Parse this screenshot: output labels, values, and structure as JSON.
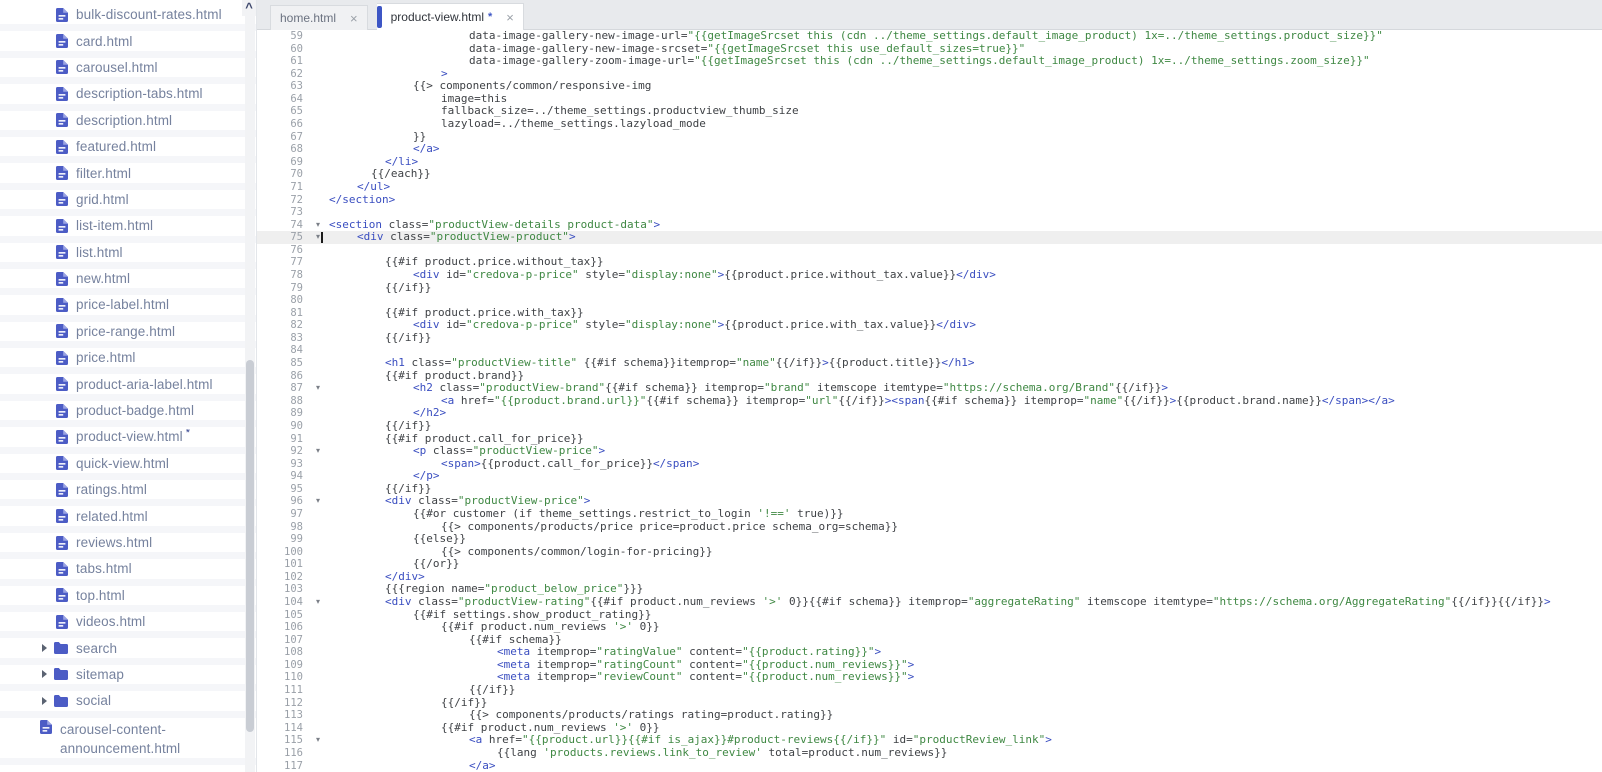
{
  "colors": {
    "accent_blue": "#3d56c5",
    "icon_indigo": "#4c5cc5",
    "syntax_tag": "#3a4ec0",
    "syntax_string": "#3f8843",
    "syntax_text": "#3f4246",
    "active_line_bg": "#efefef"
  },
  "sidebar": {
    "items": [
      {
        "type": "file",
        "name": "bulk-discount-rates.html"
      },
      {
        "type": "file",
        "name": "card.html"
      },
      {
        "type": "file",
        "name": "carousel.html"
      },
      {
        "type": "file",
        "name": "description-tabs.html"
      },
      {
        "type": "file",
        "name": "description.html"
      },
      {
        "type": "file",
        "name": "featured.html"
      },
      {
        "type": "file",
        "name": "filter.html"
      },
      {
        "type": "file",
        "name": "grid.html"
      },
      {
        "type": "file",
        "name": "list-item.html"
      },
      {
        "type": "file",
        "name": "list.html"
      },
      {
        "type": "file",
        "name": "new.html"
      },
      {
        "type": "file",
        "name": "price-label.html"
      },
      {
        "type": "file",
        "name": "price-range.html"
      },
      {
        "type": "file",
        "name": "price.html"
      },
      {
        "type": "file",
        "name": "product-aria-label.html"
      },
      {
        "type": "file",
        "name": "product-badge.html"
      },
      {
        "type": "file",
        "name": "product-view.html",
        "modified": true
      },
      {
        "type": "file",
        "name": "quick-view.html"
      },
      {
        "type": "file",
        "name": "ratings.html"
      },
      {
        "type": "file",
        "name": "related.html"
      },
      {
        "type": "file",
        "name": "reviews.html"
      },
      {
        "type": "file",
        "name": "tabs.html"
      },
      {
        "type": "file",
        "name": "top.html"
      },
      {
        "type": "file",
        "name": "videos.html"
      },
      {
        "type": "folder",
        "name": "search"
      },
      {
        "type": "folder",
        "name": "sitemap"
      },
      {
        "type": "folder",
        "name": "social"
      },
      {
        "type": "file",
        "name": "carousel-content-announcement.html",
        "outdent": true
      }
    ]
  },
  "tabs": [
    {
      "label": "home.html",
      "active": false,
      "modified": false
    },
    {
      "label": "product-view.html",
      "active": true,
      "modified": true
    }
  ],
  "editor": {
    "first_line": 59,
    "last_line": 117,
    "active_line": 75,
    "cursor": {
      "line": 75,
      "col": 0
    },
    "fold_lines": [
      74,
      75,
      87,
      92,
      96,
      104,
      115
    ],
    "lines": [
      {
        "n": 59,
        "i": 20,
        "t": "data-image-gallery-new-image-url=\"{{getImageSrcset this (cdn ../theme_settings.default_image_product) 1x=../theme_settings.product_size}}\""
      },
      {
        "n": 60,
        "i": 20,
        "t": "data-image-gallery-new-image-srcset=\"{{getImageSrcset this use_default_sizes=true}}\""
      },
      {
        "n": 61,
        "i": 20,
        "t": "data-image-gallery-zoom-image-url=\"{{getImageSrcset this (cdn ../theme_settings.default_image_product) 1x=../theme_settings.zoom_size}}\""
      },
      {
        "n": 62,
        "i": 16,
        "t": ">"
      },
      {
        "n": 63,
        "i": 12,
        "t": "{{> components/common/responsive-img"
      },
      {
        "n": 64,
        "i": 16,
        "t": "image=this"
      },
      {
        "n": 65,
        "i": 16,
        "t": "fallback_size=../theme_settings.productview_thumb_size"
      },
      {
        "n": 66,
        "i": 16,
        "t": "lazyload=../theme_settings.lazyload_mode"
      },
      {
        "n": 67,
        "i": 12,
        "t": "}}"
      },
      {
        "n": 68,
        "i": 12,
        "t": "</a>"
      },
      {
        "n": 69,
        "i": 8,
        "t": "</li>"
      },
      {
        "n": 70,
        "i": 6,
        "t": "{{/each}}"
      },
      {
        "n": 71,
        "i": 4,
        "t": "</ul>"
      },
      {
        "n": 72,
        "i": 0,
        "t": "</section>"
      },
      {
        "n": 73,
        "i": 0,
        "t": ""
      },
      {
        "n": 74,
        "i": 0,
        "t": "<section class=\"productView-details product-data\">"
      },
      {
        "n": 75,
        "i": 4,
        "t": "<div class=\"productView-product\">"
      },
      {
        "n": 76,
        "i": 0,
        "t": ""
      },
      {
        "n": 77,
        "i": 8,
        "t": "{{#if product.price.without_tax}}"
      },
      {
        "n": 78,
        "i": 12,
        "t": "<div id=\"credova-p-price\" style=\"display:none\">{{product.price.without_tax.value}}</div>"
      },
      {
        "n": 79,
        "i": 8,
        "t": "{{/if}}"
      },
      {
        "n": 80,
        "i": 0,
        "t": ""
      },
      {
        "n": 81,
        "i": 8,
        "t": "{{#if product.price.with_tax}}"
      },
      {
        "n": 82,
        "i": 12,
        "t": "<div id=\"credova-p-price\" style=\"display:none\">{{product.price.with_tax.value}}</div>"
      },
      {
        "n": 83,
        "i": 8,
        "t": "{{/if}}"
      },
      {
        "n": 84,
        "i": 0,
        "t": ""
      },
      {
        "n": 85,
        "i": 8,
        "t": "<h1 class=\"productView-title\" {{#if schema}}itemprop=\"name\"{{/if}}>{{product.title}}</h1>"
      },
      {
        "n": 86,
        "i": 8,
        "t": "{{#if product.brand}}"
      },
      {
        "n": 87,
        "i": 12,
        "t": "<h2 class=\"productView-brand\"{{#if schema}} itemprop=\"brand\" itemscope itemtype=\"https://schema.org/Brand\"{{/if}}>"
      },
      {
        "n": 88,
        "i": 16,
        "t": "<a href=\"{{product.brand.url}}\"{{#if schema}} itemprop=\"url\"{{/if}}><span{{#if schema}} itemprop=\"name\"{{/if}}>{{product.brand.name}}</span></a>"
      },
      {
        "n": 89,
        "i": 12,
        "t": "</h2>"
      },
      {
        "n": 90,
        "i": 8,
        "t": "{{/if}}"
      },
      {
        "n": 91,
        "i": 8,
        "t": "{{#if product.call_for_price}}"
      },
      {
        "n": 92,
        "i": 12,
        "t": "<p class=\"productView-price\">"
      },
      {
        "n": 93,
        "i": 16,
        "t": "<span>{{product.call_for_price}}</span>"
      },
      {
        "n": 94,
        "i": 12,
        "t": "</p>"
      },
      {
        "n": 95,
        "i": 8,
        "t": "{{/if}}"
      },
      {
        "n": 96,
        "i": 8,
        "t": "<div class=\"productView-price\">"
      },
      {
        "n": 97,
        "i": 12,
        "t": "{{#or customer (if theme_settings.restrict_to_login '!==' true)}}"
      },
      {
        "n": 98,
        "i": 16,
        "t": "{{> components/products/price price=product.price schema_org=schema}}"
      },
      {
        "n": 99,
        "i": 12,
        "t": "{{else}}"
      },
      {
        "n": 100,
        "i": 16,
        "t": "{{> components/common/login-for-pricing}}"
      },
      {
        "n": 101,
        "i": 12,
        "t": "{{/or}}"
      },
      {
        "n": 102,
        "i": 8,
        "t": "</div>"
      },
      {
        "n": 103,
        "i": 8,
        "t": "{{{region name=\"product_below_price\"}}}"
      },
      {
        "n": 104,
        "i": 8,
        "t": "<div class=\"productView-rating\"{{#if product.num_reviews '>' 0}}{{#if schema}} itemprop=\"aggregateRating\" itemscope itemtype=\"https://schema.org/AggregateRating\"{{/if}}{{/if}}>"
      },
      {
        "n": 105,
        "i": 12,
        "t": "{{#if settings.show_product_rating}}"
      },
      {
        "n": 106,
        "i": 16,
        "t": "{{#if product.num_reviews '>' 0}}"
      },
      {
        "n": 107,
        "i": 20,
        "t": "{{#if schema}}"
      },
      {
        "n": 108,
        "i": 24,
        "t": "<meta itemprop=\"ratingValue\" content=\"{{product.rating}}\">"
      },
      {
        "n": 109,
        "i": 24,
        "t": "<meta itemprop=\"ratingCount\" content=\"{{product.num_reviews}}\">"
      },
      {
        "n": 110,
        "i": 24,
        "t": "<meta itemprop=\"reviewCount\" content=\"{{product.num_reviews}}\">"
      },
      {
        "n": 111,
        "i": 20,
        "t": "{{/if}}"
      },
      {
        "n": 112,
        "i": 16,
        "t": "{{/if}}"
      },
      {
        "n": 113,
        "i": 20,
        "t": "{{> components/products/ratings rating=product.rating}}"
      },
      {
        "n": 114,
        "i": 16,
        "t": "{{#if product.num_reviews '>' 0}}"
      },
      {
        "n": 115,
        "i": 20,
        "t": "<a href=\"{{product.url}}{{#if is_ajax}}#product-reviews{{/if}}\" id=\"productReview_link\">"
      },
      {
        "n": 116,
        "i": 24,
        "t": "{{lang 'products.reviews.link_to_review' total=product.num_reviews}}"
      },
      {
        "n": 117,
        "i": 20,
        "t": "</a>"
      }
    ]
  }
}
